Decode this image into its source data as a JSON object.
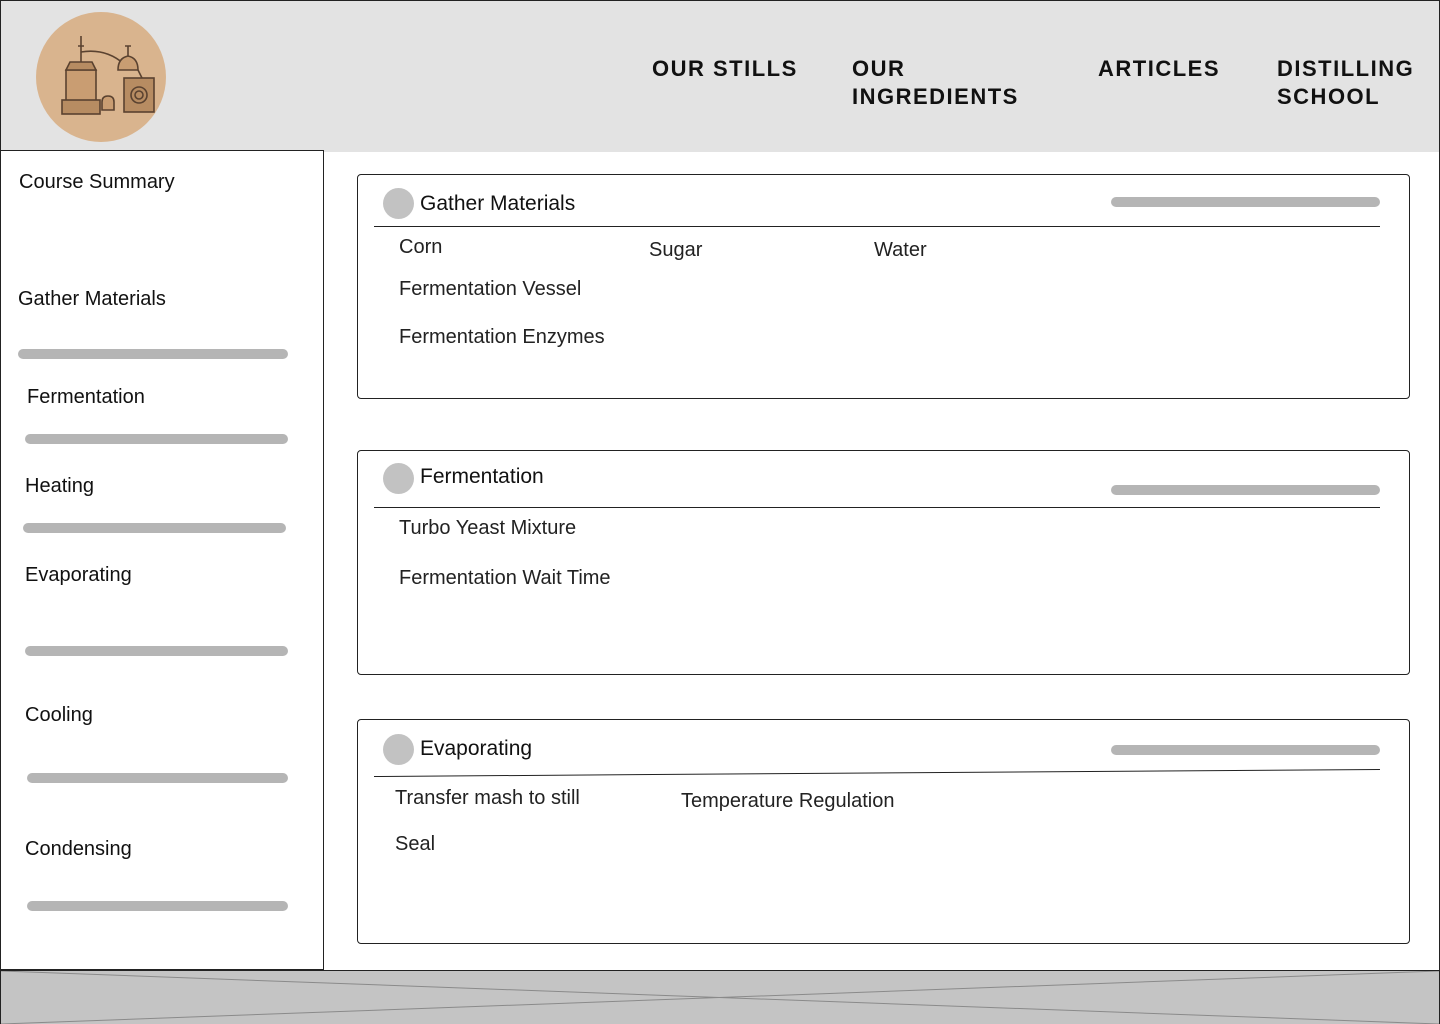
{
  "header": {
    "logo_icon": "distillery-still-logo",
    "nav": [
      {
        "line1": "OUR STILLS",
        "line2": ""
      },
      {
        "line1": "OUR",
        "line2": "INGREDIENTS"
      },
      {
        "line1": "ARTICLES",
        "line2": ""
      },
      {
        "line1": "DISTILLING",
        "line2": "SCHOOL"
      }
    ]
  },
  "sidebar": {
    "title": "Course Summary",
    "items": [
      {
        "label": "Gather Materials"
      },
      {
        "label": "Fermentation"
      },
      {
        "label": "Heating"
      },
      {
        "label": "Evaporating"
      },
      {
        "label": "Cooling"
      },
      {
        "label": "Condensing"
      }
    ]
  },
  "cards": [
    {
      "title": "Gather Materials",
      "items": [
        "Corn",
        "Sugar",
        "Water",
        "Fermentation Vessel",
        "Fermentation Enzymes"
      ]
    },
    {
      "title": "Fermentation",
      "items": [
        "Turbo Yeast Mixture",
        "Fermentation Wait Time"
      ]
    },
    {
      "title": "Evaporating",
      "items": [
        "Transfer mash to still",
        "Temperature Regulation",
        "Seal"
      ]
    }
  ],
  "colors": {
    "header_bg": "#e3e3e3",
    "logo_bg": "#d9b48e",
    "progress_bar": "#b5b5b5",
    "footer_bg": "#c4c4c4"
  }
}
